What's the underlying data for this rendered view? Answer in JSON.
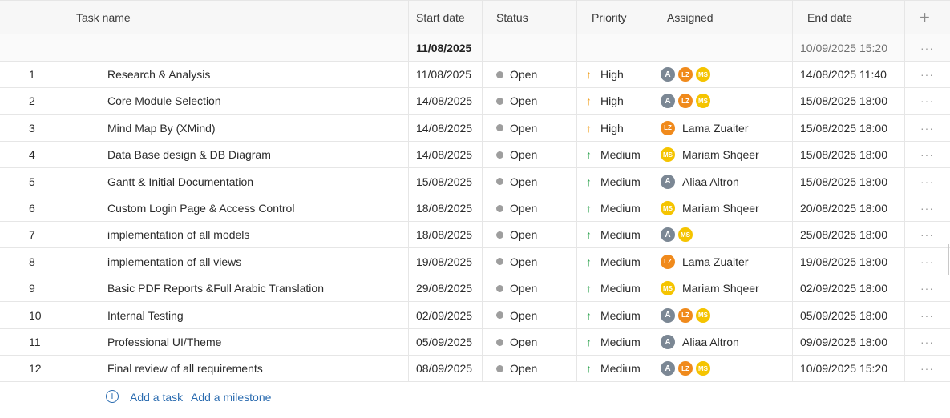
{
  "columns": {
    "task_name": "Task name",
    "start_date": "Start date",
    "status": "Status",
    "priority": "Priority",
    "assigned": "Assigned",
    "end_date": "End date",
    "add_column": "+"
  },
  "summary": {
    "start_date": "11/08/2025",
    "end_date": "10/09/2025 15:20",
    "more": "···"
  },
  "tasks": [
    {
      "num": "1",
      "name": "Research & Analysis",
      "start": "11/08/2025",
      "status": "Open",
      "priority": "High",
      "assigned": [
        "A",
        "LZ",
        "MS"
      ],
      "assigned_name": "",
      "end": "14/08/2025 11:40",
      "more": "···"
    },
    {
      "num": "2",
      "name": "Core Module Selection",
      "start": "14/08/2025",
      "status": "Open",
      "priority": "High",
      "assigned": [
        "A",
        "LZ",
        "MS"
      ],
      "assigned_name": "",
      "end": "15/08/2025 18:00",
      "more": "···"
    },
    {
      "num": "3",
      "name": "Mind Map By (XMind)",
      "start": "14/08/2025",
      "status": "Open",
      "priority": "High",
      "assigned": [
        "LZ"
      ],
      "assigned_name": "Lama Zuaiter",
      "end": "15/08/2025 18:00",
      "more": "···"
    },
    {
      "num": "4",
      "name": "Data Base design & DB Diagram",
      "start": "14/08/2025",
      "status": "Open",
      "priority": "Medium",
      "assigned": [
        "MS"
      ],
      "assigned_name": "Mariam Shqeer",
      "end": "15/08/2025 18:00",
      "more": "···"
    },
    {
      "num": "5",
      "name": "Gantt & Initial Documentation",
      "start": "15/08/2025",
      "status": "Open",
      "priority": "Medium",
      "assigned": [
        "A"
      ],
      "assigned_name": "Aliaa Altron",
      "end": "15/08/2025 18:00",
      "more": "···"
    },
    {
      "num": "6",
      "name": "Custom Login Page & Access Control",
      "start": "18/08/2025",
      "status": "Open",
      "priority": "Medium",
      "assigned": [
        "MS"
      ],
      "assigned_name": "Mariam Shqeer",
      "end": "20/08/2025 18:00",
      "more": "···"
    },
    {
      "num": "7",
      "name": "implementation of all models",
      "start": "18/08/2025",
      "status": "Open",
      "priority": "Medium",
      "assigned": [
        "A",
        "MS"
      ],
      "assigned_name": "",
      "end": "25/08/2025 18:00",
      "more": "···"
    },
    {
      "num": "8",
      "name": "implementation of all views",
      "start": "19/08/2025",
      "status": "Open",
      "priority": "Medium",
      "assigned": [
        "LZ"
      ],
      "assigned_name": "Lama Zuaiter",
      "end": "19/08/2025 18:00",
      "more": "···"
    },
    {
      "num": "9",
      "name": "Basic PDF Reports &Full Arabic Translation",
      "start": "29/08/2025",
      "status": "Open",
      "priority": "Medium",
      "assigned": [
        "MS"
      ],
      "assigned_name": "Mariam Shqeer",
      "end": "02/09/2025 18:00",
      "more": "···"
    },
    {
      "num": "10",
      "name": "Internal Testing",
      "start": "02/09/2025",
      "status": "Open",
      "priority": "Medium",
      "assigned": [
        "A",
        "LZ",
        "MS"
      ],
      "assigned_name": "",
      "end": "05/09/2025 18:00",
      "more": "···"
    },
    {
      "num": "11",
      "name": "Professional UI/Theme",
      "start": "05/09/2025",
      "status": "Open",
      "priority": "Medium",
      "assigned": [
        "A"
      ],
      "assigned_name": "Aliaa Altron",
      "end": "09/09/2025 18:00",
      "more": "···"
    },
    {
      "num": "12",
      "name": "Final review of all requirements",
      "start": "08/09/2025",
      "status": "Open",
      "priority": "Medium",
      "assigned": [
        "A",
        "LZ",
        "MS"
      ],
      "assigned_name": "",
      "end": "10/09/2025 15:20",
      "more": "···"
    }
  ],
  "footer": {
    "add_task": "Add a task",
    "add_milestone": "Add a milestone"
  },
  "icons": {
    "priority_high": "arrow-up-orange",
    "priority_medium": "arrow-up-green",
    "status_dot": "grey-dot"
  },
  "colors": {
    "high": "#f0a020",
    "medium": "#2ea44f",
    "link": "#2b6cb0",
    "avatar_a": "#7b8794",
    "avatar_lz": "#f08a1c",
    "avatar_ms": "#f5c400"
  }
}
